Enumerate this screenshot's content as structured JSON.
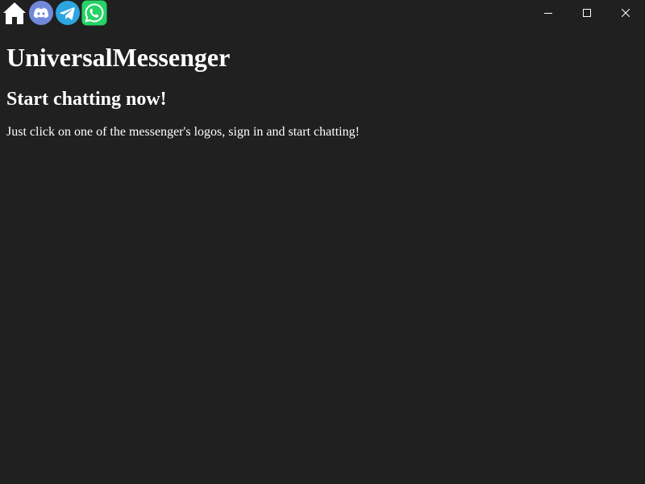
{
  "titlebar": {
    "apps": [
      {
        "name": "home",
        "icon": "home-icon",
        "color": "#ffffff"
      },
      {
        "name": "discord",
        "icon": "discord-icon",
        "color": "#7289da"
      },
      {
        "name": "telegram",
        "icon": "telegram-icon",
        "color": "#2ca5e0"
      },
      {
        "name": "whatsapp",
        "icon": "whatsapp-icon",
        "color": "#25d366"
      }
    ],
    "controls": [
      {
        "icon": "minimize-icon"
      },
      {
        "icon": "maximize-icon"
      },
      {
        "icon": "close-icon"
      }
    ]
  },
  "main": {
    "title": "UniversalMessenger",
    "subtitle": "Start chatting now!",
    "description": "Just click on one of the messenger's logos, sign in and start chatting!"
  },
  "colors": {
    "background": "#202020",
    "text": "#ffffff"
  }
}
